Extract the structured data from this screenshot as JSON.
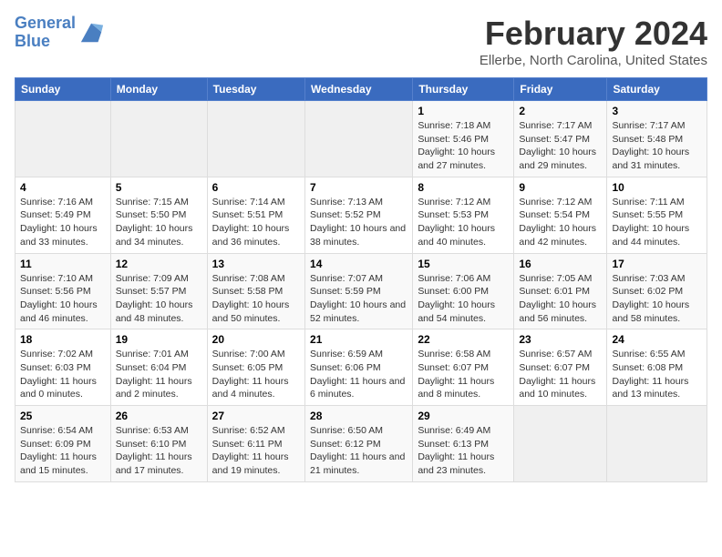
{
  "header": {
    "logo_line1": "General",
    "logo_line2": "Blue",
    "title": "February 2024",
    "subtitle": "Ellerbe, North Carolina, United States"
  },
  "weekdays": [
    "Sunday",
    "Monday",
    "Tuesday",
    "Wednesday",
    "Thursday",
    "Friday",
    "Saturday"
  ],
  "weeks": [
    [
      {
        "day": "",
        "sunrise": "",
        "sunset": "",
        "daylight": "",
        "empty": true
      },
      {
        "day": "",
        "sunrise": "",
        "sunset": "",
        "daylight": "",
        "empty": true
      },
      {
        "day": "",
        "sunrise": "",
        "sunset": "",
        "daylight": "",
        "empty": true
      },
      {
        "day": "",
        "sunrise": "",
        "sunset": "",
        "daylight": "",
        "empty": true
      },
      {
        "day": "1",
        "sunrise": "Sunrise: 7:18 AM",
        "sunset": "Sunset: 5:46 PM",
        "daylight": "Daylight: 10 hours and 27 minutes."
      },
      {
        "day": "2",
        "sunrise": "Sunrise: 7:17 AM",
        "sunset": "Sunset: 5:47 PM",
        "daylight": "Daylight: 10 hours and 29 minutes."
      },
      {
        "day": "3",
        "sunrise": "Sunrise: 7:17 AM",
        "sunset": "Sunset: 5:48 PM",
        "daylight": "Daylight: 10 hours and 31 minutes."
      }
    ],
    [
      {
        "day": "4",
        "sunrise": "Sunrise: 7:16 AM",
        "sunset": "Sunset: 5:49 PM",
        "daylight": "Daylight: 10 hours and 33 minutes."
      },
      {
        "day": "5",
        "sunrise": "Sunrise: 7:15 AM",
        "sunset": "Sunset: 5:50 PM",
        "daylight": "Daylight: 10 hours and 34 minutes."
      },
      {
        "day": "6",
        "sunrise": "Sunrise: 7:14 AM",
        "sunset": "Sunset: 5:51 PM",
        "daylight": "Daylight: 10 hours and 36 minutes."
      },
      {
        "day": "7",
        "sunrise": "Sunrise: 7:13 AM",
        "sunset": "Sunset: 5:52 PM",
        "daylight": "Daylight: 10 hours and 38 minutes."
      },
      {
        "day": "8",
        "sunrise": "Sunrise: 7:12 AM",
        "sunset": "Sunset: 5:53 PM",
        "daylight": "Daylight: 10 hours and 40 minutes."
      },
      {
        "day": "9",
        "sunrise": "Sunrise: 7:12 AM",
        "sunset": "Sunset: 5:54 PM",
        "daylight": "Daylight: 10 hours and 42 minutes."
      },
      {
        "day": "10",
        "sunrise": "Sunrise: 7:11 AM",
        "sunset": "Sunset: 5:55 PM",
        "daylight": "Daylight: 10 hours and 44 minutes."
      }
    ],
    [
      {
        "day": "11",
        "sunrise": "Sunrise: 7:10 AM",
        "sunset": "Sunset: 5:56 PM",
        "daylight": "Daylight: 10 hours and 46 minutes."
      },
      {
        "day": "12",
        "sunrise": "Sunrise: 7:09 AM",
        "sunset": "Sunset: 5:57 PM",
        "daylight": "Daylight: 10 hours and 48 minutes."
      },
      {
        "day": "13",
        "sunrise": "Sunrise: 7:08 AM",
        "sunset": "Sunset: 5:58 PM",
        "daylight": "Daylight: 10 hours and 50 minutes."
      },
      {
        "day": "14",
        "sunrise": "Sunrise: 7:07 AM",
        "sunset": "Sunset: 5:59 PM",
        "daylight": "Daylight: 10 hours and 52 minutes."
      },
      {
        "day": "15",
        "sunrise": "Sunrise: 7:06 AM",
        "sunset": "Sunset: 6:00 PM",
        "daylight": "Daylight: 10 hours and 54 minutes."
      },
      {
        "day": "16",
        "sunrise": "Sunrise: 7:05 AM",
        "sunset": "Sunset: 6:01 PM",
        "daylight": "Daylight: 10 hours and 56 minutes."
      },
      {
        "day": "17",
        "sunrise": "Sunrise: 7:03 AM",
        "sunset": "Sunset: 6:02 PM",
        "daylight": "Daylight: 10 hours and 58 minutes."
      }
    ],
    [
      {
        "day": "18",
        "sunrise": "Sunrise: 7:02 AM",
        "sunset": "Sunset: 6:03 PM",
        "daylight": "Daylight: 11 hours and 0 minutes."
      },
      {
        "day": "19",
        "sunrise": "Sunrise: 7:01 AM",
        "sunset": "Sunset: 6:04 PM",
        "daylight": "Daylight: 11 hours and 2 minutes."
      },
      {
        "day": "20",
        "sunrise": "Sunrise: 7:00 AM",
        "sunset": "Sunset: 6:05 PM",
        "daylight": "Daylight: 11 hours and 4 minutes."
      },
      {
        "day": "21",
        "sunrise": "Sunrise: 6:59 AM",
        "sunset": "Sunset: 6:06 PM",
        "daylight": "Daylight: 11 hours and 6 minutes."
      },
      {
        "day": "22",
        "sunrise": "Sunrise: 6:58 AM",
        "sunset": "Sunset: 6:07 PM",
        "daylight": "Daylight: 11 hours and 8 minutes."
      },
      {
        "day": "23",
        "sunrise": "Sunrise: 6:57 AM",
        "sunset": "Sunset: 6:07 PM",
        "daylight": "Daylight: 11 hours and 10 minutes."
      },
      {
        "day": "24",
        "sunrise": "Sunrise: 6:55 AM",
        "sunset": "Sunset: 6:08 PM",
        "daylight": "Daylight: 11 hours and 13 minutes."
      }
    ],
    [
      {
        "day": "25",
        "sunrise": "Sunrise: 6:54 AM",
        "sunset": "Sunset: 6:09 PM",
        "daylight": "Daylight: 11 hours and 15 minutes."
      },
      {
        "day": "26",
        "sunrise": "Sunrise: 6:53 AM",
        "sunset": "Sunset: 6:10 PM",
        "daylight": "Daylight: 11 hours and 17 minutes."
      },
      {
        "day": "27",
        "sunrise": "Sunrise: 6:52 AM",
        "sunset": "Sunset: 6:11 PM",
        "daylight": "Daylight: 11 hours and 19 minutes."
      },
      {
        "day": "28",
        "sunrise": "Sunrise: 6:50 AM",
        "sunset": "Sunset: 6:12 PM",
        "daylight": "Daylight: 11 hours and 21 minutes."
      },
      {
        "day": "29",
        "sunrise": "Sunrise: 6:49 AM",
        "sunset": "Sunset: 6:13 PM",
        "daylight": "Daylight: 11 hours and 23 minutes."
      },
      {
        "day": "",
        "sunrise": "",
        "sunset": "",
        "daylight": "",
        "empty": true
      },
      {
        "day": "",
        "sunrise": "",
        "sunset": "",
        "daylight": "",
        "empty": true
      }
    ]
  ]
}
